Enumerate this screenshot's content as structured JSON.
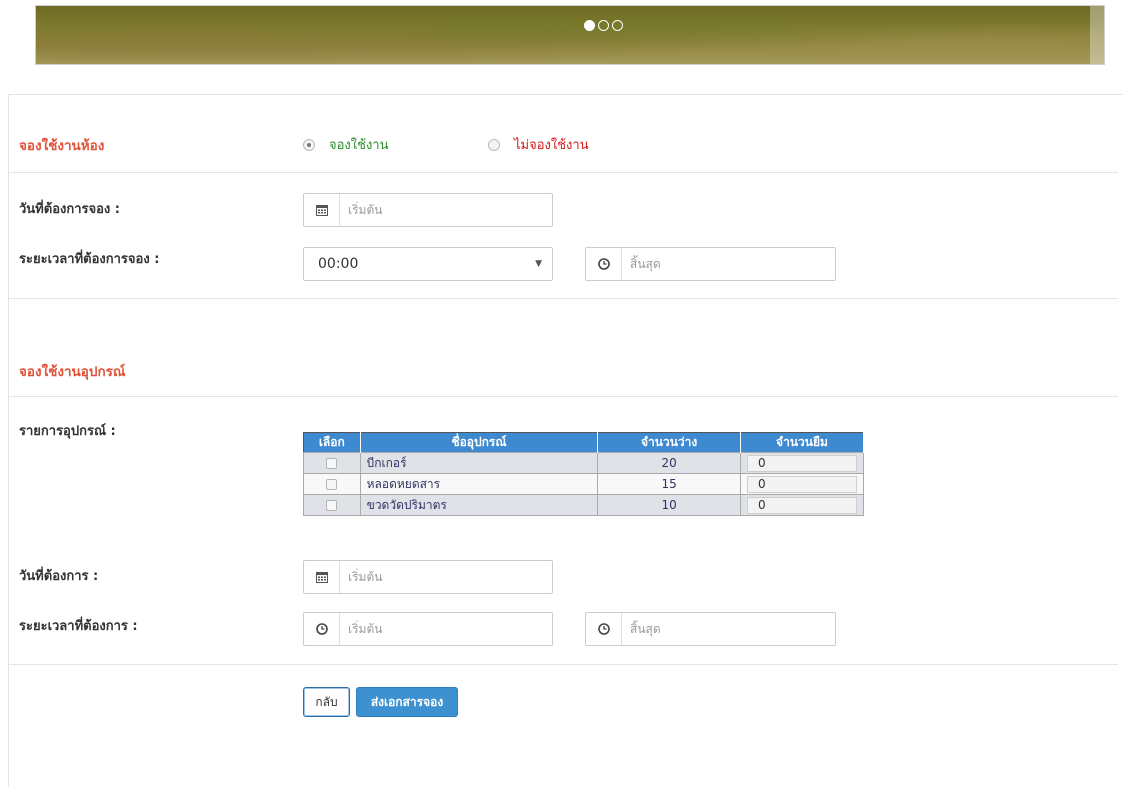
{
  "carousel": {
    "slide_count": 3,
    "active_slide": 1
  },
  "room_section": {
    "title": "จองใช้งานห้อง",
    "options": [
      {
        "label": "จองใช้งาน",
        "selected": true,
        "color": "#2e8b2e"
      },
      {
        "label": "ไม่จองใช้งาน",
        "selected": false,
        "color": "#d21a1a"
      }
    ],
    "date_label": "วันที่ต้องการจอง :",
    "date_placeholder": "เริ่มต้น",
    "time_label": "ระยะเวลาที่ต้องการจอง :",
    "start_time_value": "00:00",
    "end_time_placeholder": "สิ้นสุด"
  },
  "equipment_section": {
    "title": "จองใช้งานอุปกรณ์",
    "list_label": "รายการอุปกรณ์ :",
    "table": {
      "headers": [
        "เลือก",
        "ชื่ออุปกรณ์",
        "จำนวนว่าง",
        "จำนวนยืม"
      ],
      "rows": [
        {
          "name": "บีกเกอร์",
          "available": "20",
          "borrow": "0",
          "checked": false
        },
        {
          "name": "หลอดหยดสาร",
          "available": "15",
          "borrow": "0",
          "checked": false
        },
        {
          "name": "ขวดวัดปริมาตร",
          "available": "10",
          "borrow": "0",
          "checked": false
        }
      ]
    },
    "date_label": "วันที่ต้องการ :",
    "date_placeholder": "เริ่มต้น",
    "time_label": "ระยะเวลาที่ต้องการ :",
    "start_time_placeholder": "เริ่มต้น",
    "end_time_placeholder": "สิ้นสุด"
  },
  "buttons": {
    "back": "กลับ",
    "submit": "ส่งเอกสารจอง"
  },
  "colors": {
    "section_title": "#e0533b",
    "table_header": "#3d8ad1",
    "primary_button": "#3d91d1"
  }
}
